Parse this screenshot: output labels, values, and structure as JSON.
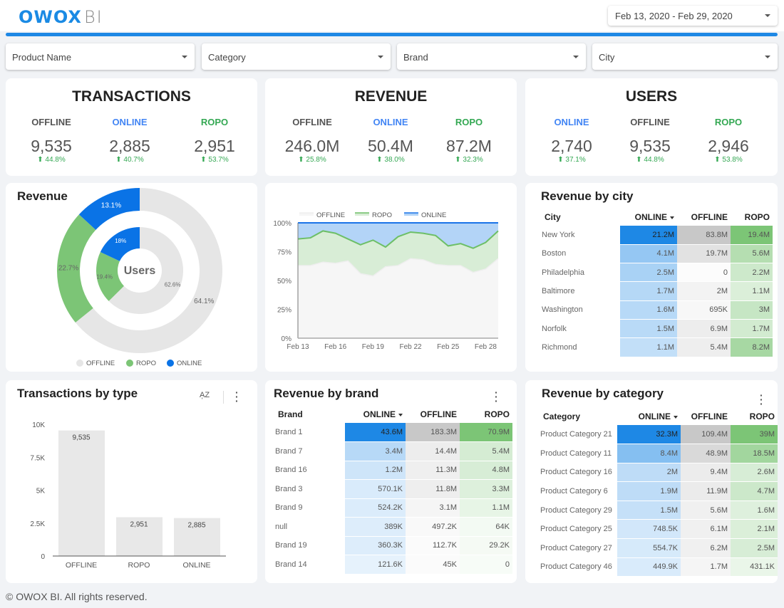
{
  "header": {
    "logo_primary": "OWOX",
    "logo_secondary": "BI",
    "date_range": "Feb 13, 2020 - Feb 29, 2020",
    "accent_color": "#1e88e5"
  },
  "filters": [
    {
      "label": "Product Name"
    },
    {
      "label": "Category"
    },
    {
      "label": "Brand"
    },
    {
      "label": "City"
    }
  ],
  "colors": {
    "offline": "#e6e6e6",
    "ropo": "#7cc576",
    "online": "#0a73e6",
    "online_label": "#4285f4",
    "ropo_label": "#34a853",
    "offline_label": "#555555",
    "delta": "#34a853"
  },
  "kpis": [
    {
      "title": "TRANSACTIONS",
      "items": [
        {
          "label": "OFFLINE",
          "kind": "offline",
          "value": "9,535",
          "delta": "44.8%"
        },
        {
          "label": "ONLINE",
          "kind": "online",
          "value": "2,885",
          "delta": "40.7%"
        },
        {
          "label": "ROPO",
          "kind": "ropo",
          "value": "2,951",
          "delta": "53.7%"
        }
      ]
    },
    {
      "title": "REVENUE",
      "items": [
        {
          "label": "OFFLINE",
          "kind": "offline",
          "value": "246.0M",
          "delta": "25.8%"
        },
        {
          "label": "ONLINE",
          "kind": "online",
          "value": "50.4M",
          "delta": "38.0%"
        },
        {
          "label": "ROPO",
          "kind": "ropo",
          "value": "87.2M",
          "delta": "32.3%"
        }
      ]
    },
    {
      "title": "USERS",
      "items": [
        {
          "label": "ONLINE",
          "kind": "online",
          "value": "2,740",
          "delta": "37.1%"
        },
        {
          "label": "OFFLINE",
          "kind": "offline",
          "value": "9,535",
          "delta": "44.8%"
        },
        {
          "label": "ROPO",
          "kind": "ropo",
          "value": "2,946",
          "delta": "53.8%"
        }
      ]
    }
  ],
  "donut": {
    "title": "Revenue",
    "center_label": "Users",
    "legend": [
      "OFFLINE",
      "ROPO",
      "ONLINE"
    ]
  },
  "area": {
    "legend": [
      "OFFLINE",
      "ROPO",
      "ONLINE"
    ]
  },
  "city_table": {
    "title": "Revenue by city",
    "headers": [
      "City",
      "ONLINE",
      "OFFLINE",
      "ROPO"
    ],
    "rows": [
      [
        "New York",
        "21.2M",
        "83.8M",
        "19.4M"
      ],
      [
        "Boston",
        "4.1M",
        "19.7M",
        "5.6M"
      ],
      [
        "Philadelphia",
        "2.5M",
        "0",
        "2.2M"
      ],
      [
        "Baltimore",
        "1.7M",
        "2M",
        "1.1M"
      ],
      [
        "Washington",
        "1.6M",
        "695K",
        "3M"
      ],
      [
        "Norfolk",
        "1.5M",
        "6.9M",
        "1.7M"
      ],
      [
        "Richmond",
        "1.1M",
        "5.4M",
        "8.2M"
      ]
    ]
  },
  "bar_card": {
    "title": "Transactions by type",
    "sort_icon": "sort-az-icon",
    "menu_icon": "more-vert-icon"
  },
  "brand_table": {
    "title": "Revenue by brand",
    "headers": [
      "Brand",
      "ONLINE",
      "OFFLINE",
      "ROPO"
    ],
    "rows": [
      [
        "Brand 1",
        "43.6M",
        "183.3M",
        "70.9M"
      ],
      [
        "Brand 7",
        "3.4M",
        "14.4M",
        "5.4M"
      ],
      [
        "Brand 16",
        "1.2M",
        "11.3M",
        "4.8M"
      ],
      [
        "Brand 3",
        "570.1K",
        "11.8M",
        "3.3M"
      ],
      [
        "Brand 9",
        "524.2K",
        "3.1M",
        "1.1M"
      ],
      [
        "null",
        "389K",
        "497.2K",
        "64K"
      ],
      [
        "Brand 19",
        "360.3K",
        "112.7K",
        "29.2K"
      ],
      [
        "Brand 14",
        "121.6K",
        "45K",
        "0"
      ]
    ]
  },
  "category_table": {
    "title": "Revenue by category",
    "headers": [
      "Category",
      "ONLINE",
      "OFFLINE",
      "ROPO"
    ],
    "rows": [
      [
        "Product Category 21",
        "32.3M",
        "109.4M",
        "39M"
      ],
      [
        "Product Category 11",
        "8.4M",
        "48.9M",
        "18.5M"
      ],
      [
        "Product Category 16",
        "2M",
        "9.4M",
        "2.6M"
      ],
      [
        "Product Category 6",
        "1.9M",
        "11.9M",
        "4.7M"
      ],
      [
        "Product Category 29",
        "1.5M",
        "5.6M",
        "1.6M"
      ],
      [
        "Product Category 25",
        "748.5K",
        "6.1M",
        "2.1M"
      ],
      [
        "Product Category 27",
        "554.7K",
        "6.2M",
        "2.5M"
      ],
      [
        "Product Category 46",
        "449.9K",
        "1.7M",
        "431.1K"
      ]
    ]
  },
  "footer": "© OWOX BI. All rights reserved.",
  "chart_data": [
    {
      "type": "pie",
      "title": "Revenue",
      "subtitle": "Users",
      "legend": [
        "OFFLINE",
        "ROPO",
        "ONLINE"
      ],
      "legend_position": "bottom",
      "rings": [
        {
          "name": "Revenue",
          "slices": [
            {
              "label": "OFFLINE",
              "value": 64.1
            },
            {
              "label": "ROPO",
              "value": 22.7
            },
            {
              "label": "ONLINE",
              "value": 13.1
            }
          ]
        },
        {
          "name": "Users",
          "slices": [
            {
              "label": "OFFLINE",
              "value": 62.6
            },
            {
              "label": "ROPO",
              "value": 19.4
            },
            {
              "label": "ONLINE",
              "value": 18.0
            }
          ]
        }
      ]
    },
    {
      "type": "area",
      "stacked_percent": true,
      "legend": [
        "OFFLINE",
        "ROPO",
        "ONLINE"
      ],
      "legend_position": "top",
      "x": [
        "Feb 13",
        "Feb 14",
        "Feb 15",
        "Feb 16",
        "Feb 17",
        "Feb 18",
        "Feb 19",
        "Feb 20",
        "Feb 21",
        "Feb 22",
        "Feb 23",
        "Feb 24",
        "Feb 25",
        "Feb 26",
        "Feb 27",
        "Feb 28",
        "Feb 29"
      ],
      "x_ticks": [
        "Feb 13",
        "Feb 16",
        "Feb 19",
        "Feb 22",
        "Feb 25",
        "Feb 28"
      ],
      "y_ticks": [
        "0%",
        "25%",
        "50%",
        "75%",
        "100%"
      ],
      "ylim": [
        0,
        100
      ],
      "series": [
        {
          "name": "OFFLINE",
          "values": [
            63,
            63,
            66,
            65,
            67,
            56,
            54,
            62,
            63,
            69,
            68,
            64,
            63,
            63,
            57,
            60,
            69
          ]
        },
        {
          "name": "ROPO",
          "values": [
            23,
            24,
            27,
            26,
            19,
            25,
            31,
            17,
            25,
            23,
            23,
            25,
            17,
            19,
            21,
            23,
            24
          ]
        },
        {
          "name": "ONLINE",
          "values": [
            14,
            13,
            7,
            9,
            14,
            19,
            15,
            21,
            12,
            8,
            9,
            11,
            20,
            18,
            22,
            17,
            7
          ]
        }
      ]
    },
    {
      "type": "bar",
      "title": "Transactions by type",
      "categories": [
        "OFFLINE",
        "ROPO",
        "ONLINE"
      ],
      "values": [
        9535,
        2951,
        2885
      ],
      "value_labels": [
        "9,535",
        "2,951",
        "2,885"
      ],
      "y_ticks": [
        "0",
        "2.5K",
        "5K",
        "7.5K",
        "10K"
      ],
      "ylim": [
        0,
        10000
      ]
    }
  ]
}
